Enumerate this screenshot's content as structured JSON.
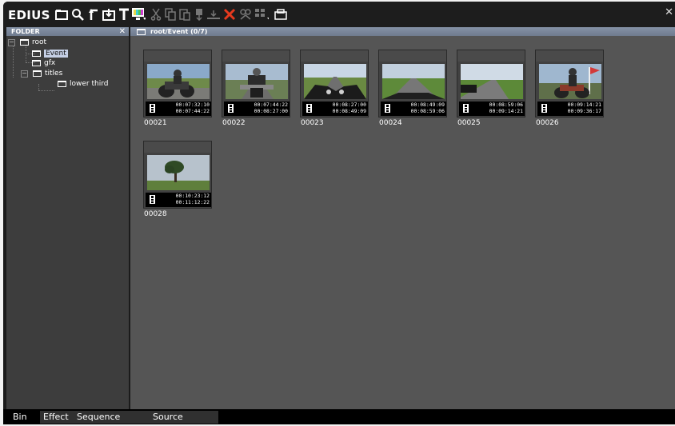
{
  "app": {
    "title": "EDIUS",
    "close_glyph": "✕"
  },
  "toolbar": {
    "buttons": [
      {
        "name": "new-folder-icon"
      },
      {
        "name": "search-icon"
      },
      {
        "name": "up-folder-icon"
      },
      {
        "name": "open-clip-icon"
      },
      {
        "name": "add-title-icon"
      },
      {
        "name": "color-bar-icon"
      },
      {
        "name": "cut-icon"
      },
      {
        "name": "copy-icon"
      },
      {
        "name": "paste-icon"
      },
      {
        "name": "add-to-timeline-icon"
      },
      {
        "name": "insert-icon"
      },
      {
        "name": "delete-icon"
      },
      {
        "name": "properties-icon"
      },
      {
        "name": "view-mode-icon"
      },
      {
        "name": "bin-icon"
      }
    ],
    "accent_delete": "#e53a1e"
  },
  "folder_pane": {
    "header": "FOLDER",
    "close_glyph": "✕",
    "tree": [
      {
        "label": "root",
        "expander": "−",
        "selected": false
      },
      {
        "label": "Event",
        "selected": true
      },
      {
        "label": "gfx",
        "selected": false
      },
      {
        "label": "titles",
        "expander": "−",
        "selected": false
      },
      {
        "label": "lower third",
        "selected": false
      }
    ]
  },
  "content": {
    "path": "root/Event (0/7)",
    "clips": [
      {
        "name": "00021",
        "tc_in": "00:07:32:10",
        "tc_out": "00:07:44:22",
        "scene": "biker-side"
      },
      {
        "name": "00022",
        "tc_in": "00:07:44:22",
        "tc_out": "00:08:27:00",
        "scene": "biker-front"
      },
      {
        "name": "00023",
        "tc_in": "00:08:27:00",
        "tc_out": "00:08:49:09",
        "scene": "handlebar-road"
      },
      {
        "name": "00024",
        "tc_in": "00:08:49:09",
        "tc_out": "00:08:59:06",
        "scene": "road-field"
      },
      {
        "name": "00025",
        "tc_in": "00:08:59:06",
        "tc_out": "00:09:14:21",
        "scene": "road-field-2"
      },
      {
        "name": "00026",
        "tc_in": "00:09:14:21",
        "tc_out": "00:09:36:17",
        "scene": "biker-flag"
      },
      {
        "name": "00028",
        "tc_in": "00:10:23:12",
        "tc_out": "00:11:12:22",
        "scene": "tree-field"
      }
    ]
  },
  "tabs": [
    {
      "label": "Bin",
      "active": true
    },
    {
      "label": "Effect",
      "active": false
    },
    {
      "label": "Sequence marker",
      "active": false
    },
    {
      "label": "Source Browser",
      "active": false
    }
  ]
}
